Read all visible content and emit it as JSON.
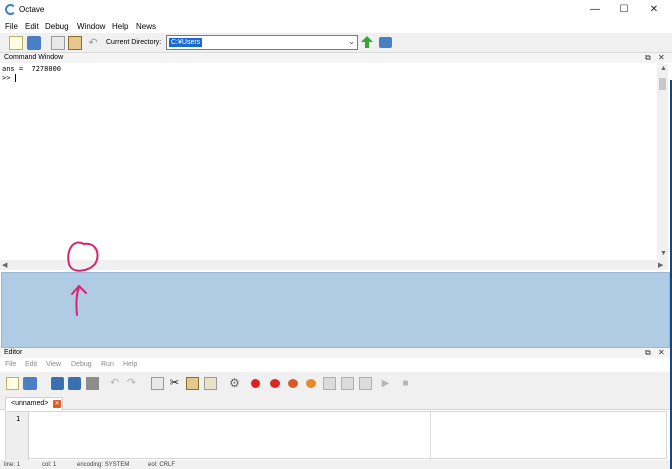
{
  "window": {
    "title": "Octave",
    "controls": {
      "minimize": "—",
      "maximize": "☐",
      "close": "✕"
    }
  },
  "menu": [
    "File",
    "Edit",
    "Debug",
    "Window",
    "Help",
    "News"
  ],
  "toolbar": {
    "icons": [
      "new-script-icon",
      "open-file-icon",
      "copy-icon",
      "paste-icon",
      "undo-icon"
    ],
    "current_directory_label": "Current Directory:",
    "current_directory_value": "C:¥Users",
    "go_up_icon": "arrow-up-icon",
    "browse_icon": "folder-icon"
  },
  "command_window": {
    "title": "Command Window",
    "lines": [
      "ans =  7278000",
      ">> "
    ]
  },
  "editor": {
    "title": "Editor",
    "menu": [
      "File",
      "Edit",
      "View",
      "Debug",
      "Run",
      "Help"
    ],
    "tab_label": "<unnamed>",
    "line_number": "1"
  },
  "status_bar": {
    "line": "line: 1",
    "col": "col: 1",
    "encoding": "encoding: SYSTEM",
    "eol": "eol: CRLF"
  },
  "colors": {
    "dock_blue": "#b0cbe4",
    "annotation_pink": "#d6246e",
    "selection_blue": "#1a6ad0"
  }
}
